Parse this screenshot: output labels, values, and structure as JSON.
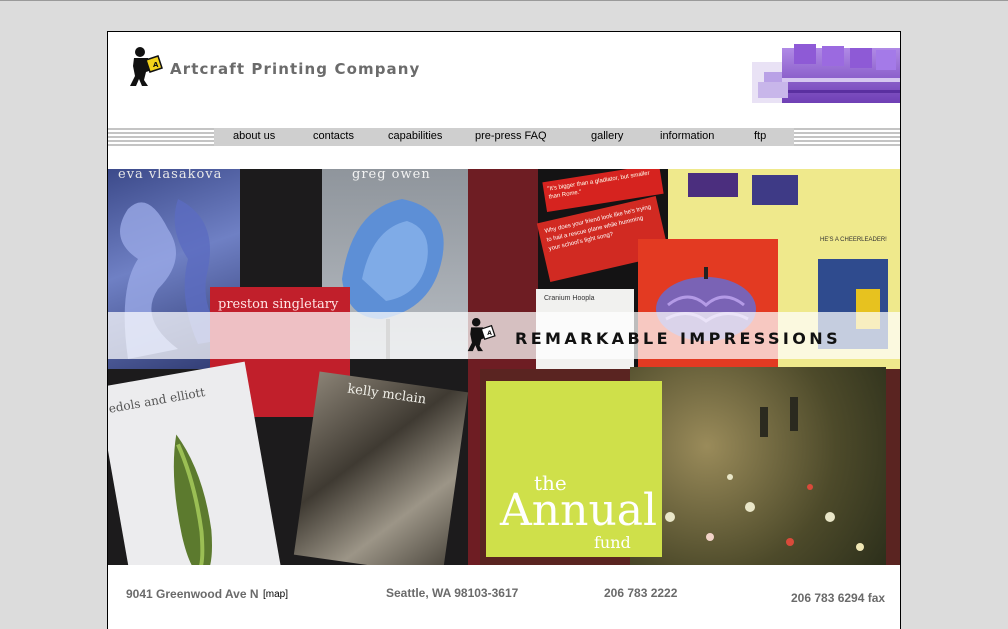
{
  "header": {
    "company_name": "Artcraft Printing Company"
  },
  "nav": {
    "items": [
      {
        "label": "about us"
      },
      {
        "label": "contacts"
      },
      {
        "label": "capabilities"
      },
      {
        "label": "pre-press FAQ"
      },
      {
        "label": "gallery"
      },
      {
        "label": "information"
      },
      {
        "label": "ftp"
      }
    ]
  },
  "hero": {
    "banner_text": "REMARKABLE IMPRESSIONS",
    "covers": {
      "eva": "eva vlasakova",
      "greg": "greg owen",
      "preston": "preston singletary",
      "edols": "edols and elliott",
      "kelly": "kelly mclain",
      "annual_the": "the",
      "annual_main": "Annual",
      "annual_fund": "fund",
      "cheer1": "\"It's bigger than a gladiator, but smaller than Rome.\"",
      "cheer2": "Why does your friend look like he's trying to hail a rescue plane while humming your school's fight song?",
      "cheer3": "HE'S A CHEERLEADER!",
      "cranium": "Cranium Hoopla"
    }
  },
  "footer": {
    "address": "9041 Greenwood Ave N",
    "map_label": "[map]",
    "city": "Seattle, WA 98103-3617",
    "phone": "206 783 2222",
    "fax": "206 783 6294 fax"
  },
  "colors": {
    "background": "#dcdcdc",
    "text_gray": "#6a6a6a",
    "nav_gray": "#cfcfcf",
    "hero_maroon": "#6e1d23",
    "press_purple": "#8a55c8"
  }
}
